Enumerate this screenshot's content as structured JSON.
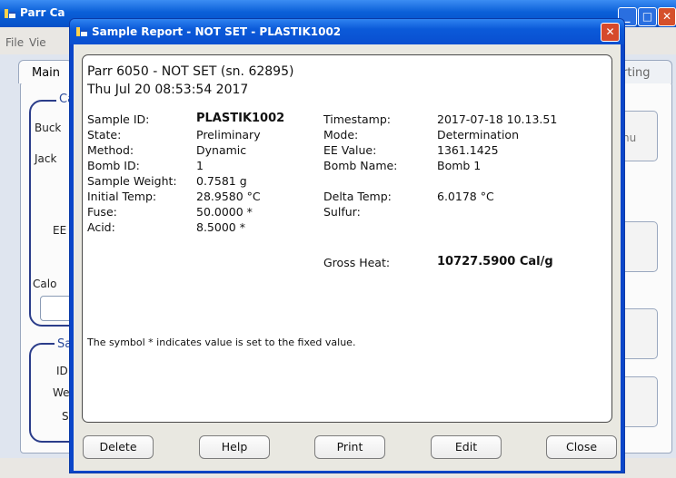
{
  "background_window": {
    "title": "Parr Ca",
    "menu": [
      "File",
      "Vie"
    ],
    "tab_main": "Main",
    "tab_right": "rting",
    "group1_title": "Ca",
    "group1_labels": [
      "Buck",
      "Jack",
      "EE",
      "Calo"
    ],
    "group2_title": "Sa",
    "group2_labels": [
      "ID",
      "We",
      "S"
    ],
    "side_button_text": "nu"
  },
  "dialog": {
    "title": "Sample Report - NOT SET - PLASTIK1002",
    "header_line1": "Parr 6050 - NOT SET (sn. 62895)",
    "header_line2": "Thu Jul 20 08:53:54 2017",
    "fields_left": [
      {
        "label": "Sample ID:",
        "value": "PLASTIK1002"
      },
      {
        "label": "State:",
        "value": "Preliminary"
      },
      {
        "label": "Method:",
        "value": "Dynamic"
      },
      {
        "label": "Bomb ID:",
        "value": "1"
      },
      {
        "label": "Sample Weight:",
        "value": "0.7581 g"
      },
      {
        "label": "Initial Temp:",
        "value": "28.9580 °C"
      },
      {
        "label": "Fuse:",
        "value": "50.0000 *"
      },
      {
        "label": "Acid:",
        "value": "8.5000 *"
      }
    ],
    "fields_right": [
      {
        "label": "Timestamp:",
        "value": "2017-07-18 10.13.51"
      },
      {
        "label": "Mode:",
        "value": "Determination"
      },
      {
        "label": "EE Value:",
        "value": "1361.1425"
      },
      {
        "label": "Bomb Name:",
        "value": "Bomb 1"
      },
      {
        "label": "Delta Temp:",
        "value": "6.0178 °C"
      },
      {
        "label": "Sulfur:",
        "value": ""
      }
    ],
    "gross_heat_label": "Gross Heat:",
    "gross_heat_value": "10727.5900 Cal/g",
    "footnote": "The symbol * indicates value is set to the fixed value.",
    "buttons": {
      "delete": "Delete",
      "help": "Help",
      "print": "Print",
      "edit": "Edit",
      "close": "Close"
    }
  },
  "colors": {
    "title_bar": "#0b5ad9",
    "close_button": "#d6492b",
    "group_border": "#2b3d8a"
  },
  "icons": {
    "app": "parr-app-icon",
    "close": "close-icon",
    "minimize": "minimize-icon",
    "maximize": "maximize-icon"
  }
}
